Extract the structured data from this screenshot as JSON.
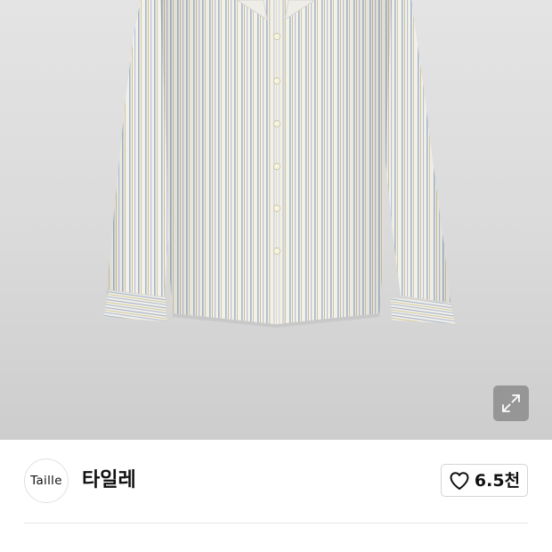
{
  "product_image": {
    "alt": "",
    "expand_icon": "expand-arrows-icon"
  },
  "brand": {
    "logo_text": "Taille",
    "name": "타일레"
  },
  "like": {
    "icon": "heart-outline-icon",
    "count": "6.5천"
  },
  "colors": {
    "image_bg": "#dadada",
    "shirt_base": "#f1efe9",
    "stripe_blue": "#9fb0c6",
    "stripe_yellow": "#d6cf8e",
    "button_overlay": "#8c8c8c",
    "border": "#d4d4d4",
    "text": "#111111"
  }
}
